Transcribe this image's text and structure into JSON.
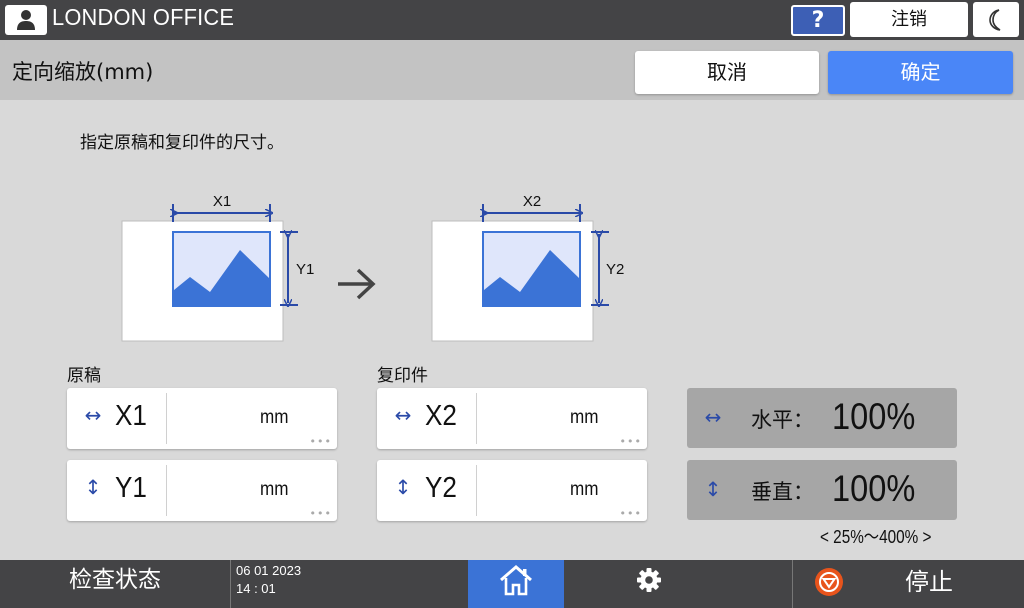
{
  "header": {
    "office_name": "LONDON OFFICE",
    "help_label": "?",
    "logout_label": "注销"
  },
  "titlebar": {
    "title": "定向缩放(mm)",
    "cancel_label": "取消",
    "ok_label": "确定"
  },
  "instruction": "指定原稿和复印件的尺寸。",
  "diagram": {
    "original": {
      "x_label": "X1",
      "y_label": "Y1"
    },
    "copy": {
      "x_label": "X2",
      "y_label": "Y2"
    },
    "arrow": "→"
  },
  "original_section": {
    "label": "原稿",
    "fields": [
      {
        "arrow": "↔",
        "name": "X1",
        "unit": "mm",
        "value": ""
      },
      {
        "arrow": "↕",
        "name": "Y1",
        "unit": "mm",
        "value": ""
      }
    ]
  },
  "copy_section": {
    "label": "复印件",
    "fields": [
      {
        "arrow": "↔",
        "name": "X2",
        "unit": "mm",
        "value": ""
      },
      {
        "arrow": "↕",
        "name": "Y2",
        "unit": "mm",
        "value": ""
      }
    ]
  },
  "ratios": [
    {
      "arrow": "↔",
      "label": "水平：",
      "value": "100%"
    },
    {
      "arrow": "↕",
      "label": "垂直：",
      "value": "100%"
    }
  ],
  "range": "< 25%～400% >",
  "footer": {
    "status_label": "检查状态",
    "date": "06 01 2023",
    "time": "14 : 01",
    "stop_label": "停止"
  },
  "colors": {
    "accent": "#4a86f7",
    "topbar": "#444446",
    "help": "#3d5fb5",
    "home": "#3b73d6",
    "stop": "#e8541c",
    "arrow_blue": "#2a4aa8"
  }
}
